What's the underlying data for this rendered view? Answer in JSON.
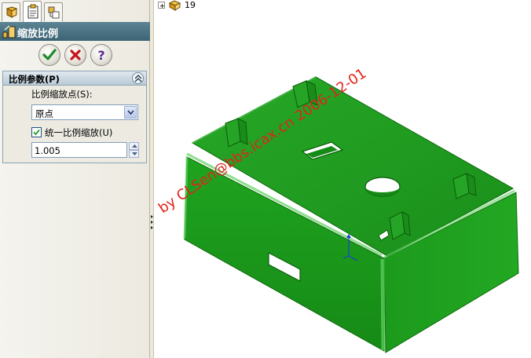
{
  "feature": {
    "title": "缩放比例",
    "tabs": [
      "feature-manager-icon",
      "property-manager-icon",
      "configuration-manager-icon"
    ],
    "actions": [
      "ok-check-icon",
      "cancel-x-icon",
      "help-question-icon"
    ]
  },
  "params_group": {
    "title": "比例参数(P)",
    "scale_about_label": "比例缩放点(S):",
    "scale_about_value": "原点",
    "uniform_label": "统一比例缩放(U)",
    "uniform_checked": true,
    "scale_value": "1.005"
  },
  "tree": {
    "item_label": "19"
  },
  "watermark": {
    "text": "by CLSen@bbs.icax.cn 2006-12-01"
  },
  "colors": {
    "model_green": "#1f9a1f",
    "watermark_red": "#e0241b",
    "title_bar": "#4a7181"
  }
}
